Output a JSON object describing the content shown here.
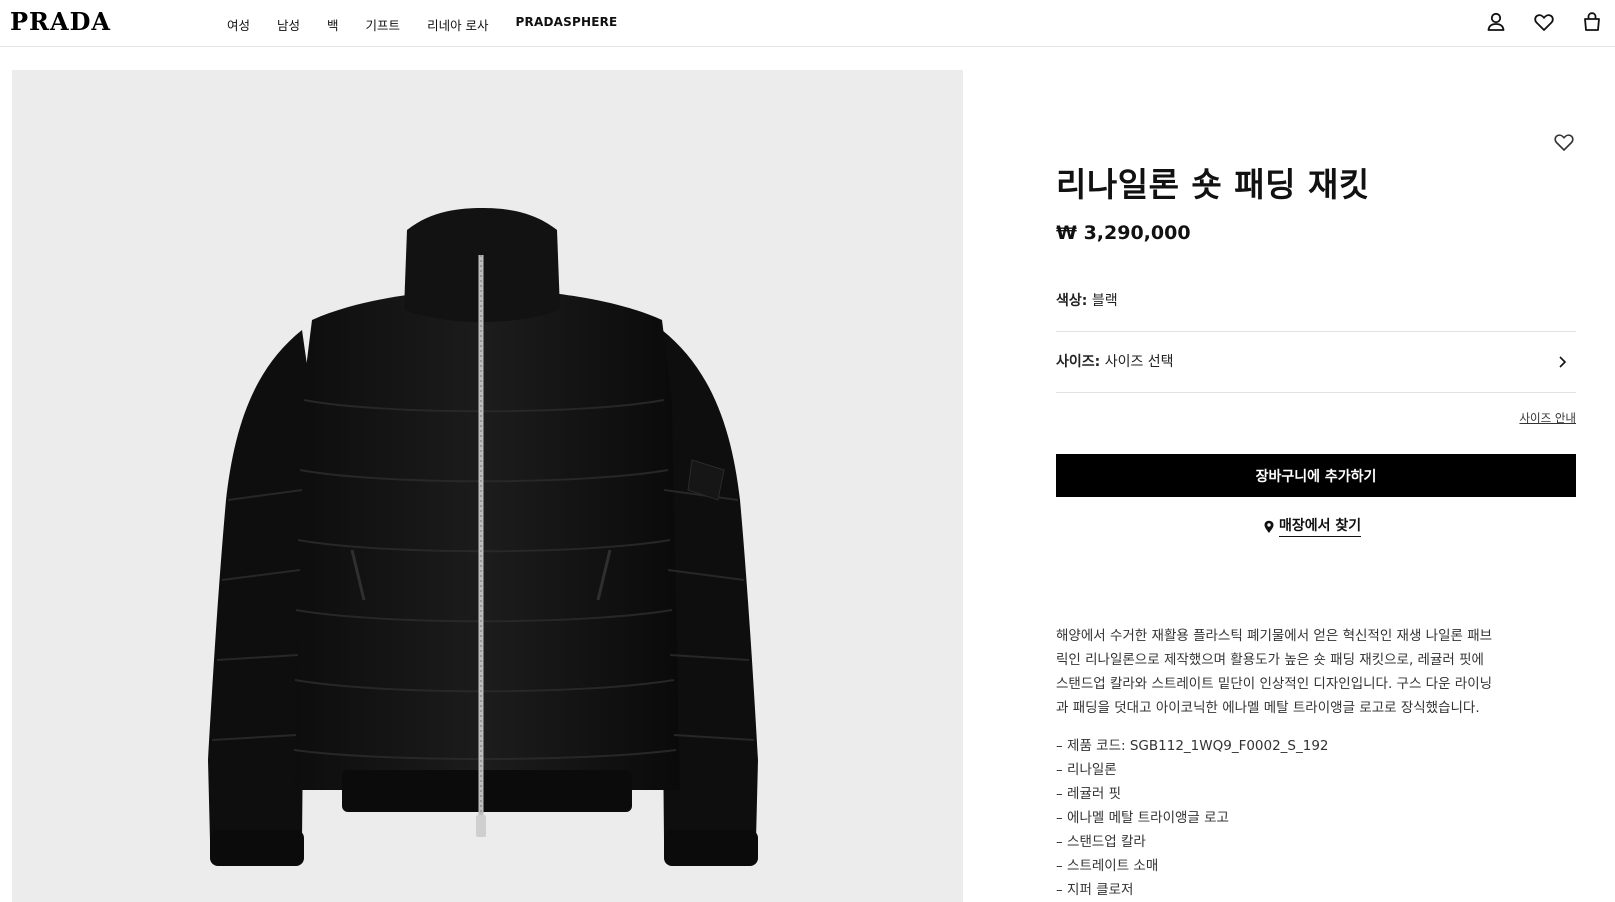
{
  "header": {
    "logo": "PRADA",
    "nav": [
      "여성",
      "남성",
      "백",
      "기프트",
      "리네아 로사",
      "PRADASPHERE"
    ],
    "icons": [
      "account-icon",
      "wishlist-icon",
      "bag-icon"
    ]
  },
  "product": {
    "image_alt": "black puffer jacket",
    "title": "리나일론 숏 패딩 재킷",
    "price": "₩ 3,290,000",
    "color_label": "색상:",
    "color_value": "블랙",
    "size_label": "사이즈:",
    "size_value": "사이즈 선택",
    "size_guide": "사이즈 안내",
    "add_to_cart": "장바구니에 추가하기",
    "find_store": "매장에서 찾기",
    "description_lines": [
      "해양에서 수거한 재활용 플라스틱 폐기물에서 얻은 혁신적인 재생 나일론 패브",
      "릭인 리나일론으로 제작했으며 활용도가 높은 숏 패딩 재킷으로, 레귤러 핏에",
      "스탠드업 칼라와 스트레이트 밑단이 인상적인 디자인입니다. 구스 다운 라이닝",
      "과 패딩을 덧대고 아이코닉한 에나멜 메탈 트라이앵글 로고로 장식했습니다."
    ],
    "features": [
      "–  제품 코드: SGB112_1WQ9_F0002_S_192",
      "–  리나일론",
      "–  레귤러 핏",
      "–  에나멜 메탈 트라이앵글 로고",
      "–  스탠드업 칼라",
      "–  스트레이트 소매",
      "–  지퍼 클로저"
    ]
  },
  "colors": {
    "primary": "#000000",
    "background": "#ffffff",
    "image_bg": "#ececec"
  }
}
